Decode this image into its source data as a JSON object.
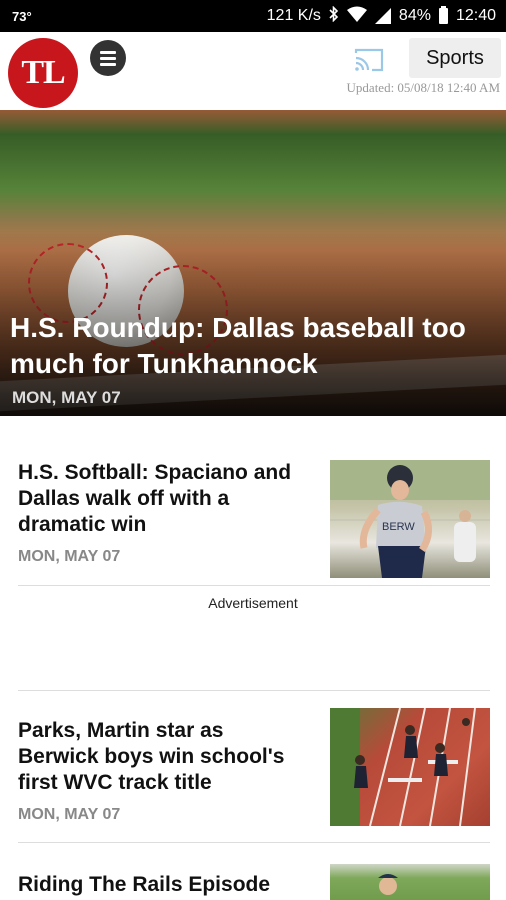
{
  "status_bar": {
    "temperature": "73°",
    "speed": "121 K/s",
    "battery": "84%",
    "time": "12:40"
  },
  "app_bar": {
    "logo_text": "TL",
    "section_label": "Sports",
    "updated_text": "Updated: 05/08/18 12:40 AM"
  },
  "hero": {
    "title": "H.S. Roundup: Dallas baseball too much for Tunkhannock",
    "date": "MON, MAY 07"
  },
  "stories": [
    {
      "headline": "H.S. Softball: Spaciano and Dallas walk off with a dramatic win",
      "date": "MON, MAY 07"
    },
    {
      "headline": "Parks, Martin star as Berwick boys win school's first WVC track title",
      "date": "MON, MAY 07"
    },
    {
      "headline": "Riding The Rails Episode"
    }
  ],
  "ad": {
    "label": "Advertisement"
  },
  "photo_text": {
    "jersey": "BERW"
  },
  "colors": {
    "brand_red": "#c8161d",
    "status_bar": "#000000"
  }
}
